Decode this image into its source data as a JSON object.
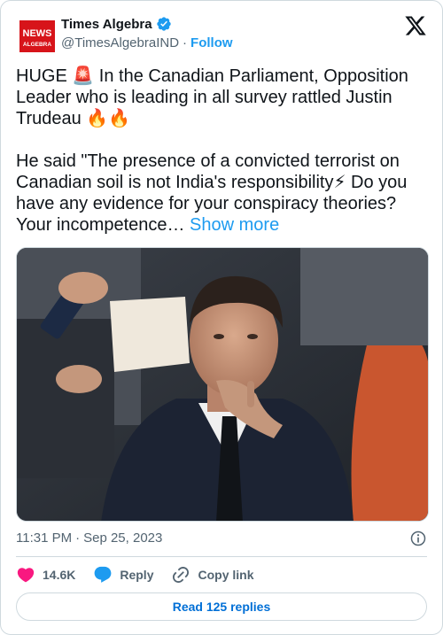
{
  "author": {
    "display_name": "Times Algebra",
    "handle": "@TimesAlgebraIND",
    "follow_label": "Follow",
    "avatar_text_line1": "NEWS",
    "avatar_text_line2": "ALGEBRA",
    "verified": true
  },
  "tweet": {
    "text": "HUGE 🚨 In the Canadian Parliament, Opposition Leader who is leading in all survey rattled Justin Trudeau 🔥🔥\n\nHe said \"The presence of a convicted terrorist on Canadian soil is not India's responsibility⚡ Do you have any evidence for your conspiracy theories? Your incompetence… ",
    "show_more_label": "Show more",
    "time": "11:31 PM",
    "separator": "·",
    "date": "Sep 25, 2023"
  },
  "actions": {
    "like_count": "14.6K",
    "reply_label": "Reply",
    "copy_link_label": "Copy link"
  },
  "read_replies_label": "Read 125 replies",
  "colors": {
    "accent": "#1d9bf0",
    "like": "#f91880",
    "reply": "#1d9bf0",
    "muted": "#536471",
    "border": "#cfd9de",
    "avatar_red": "#d7141a"
  },
  "icons": [
    "verified-badge-icon",
    "x-logo-icon",
    "info-icon",
    "heart-icon",
    "reply-bubble-icon",
    "link-icon"
  ]
}
